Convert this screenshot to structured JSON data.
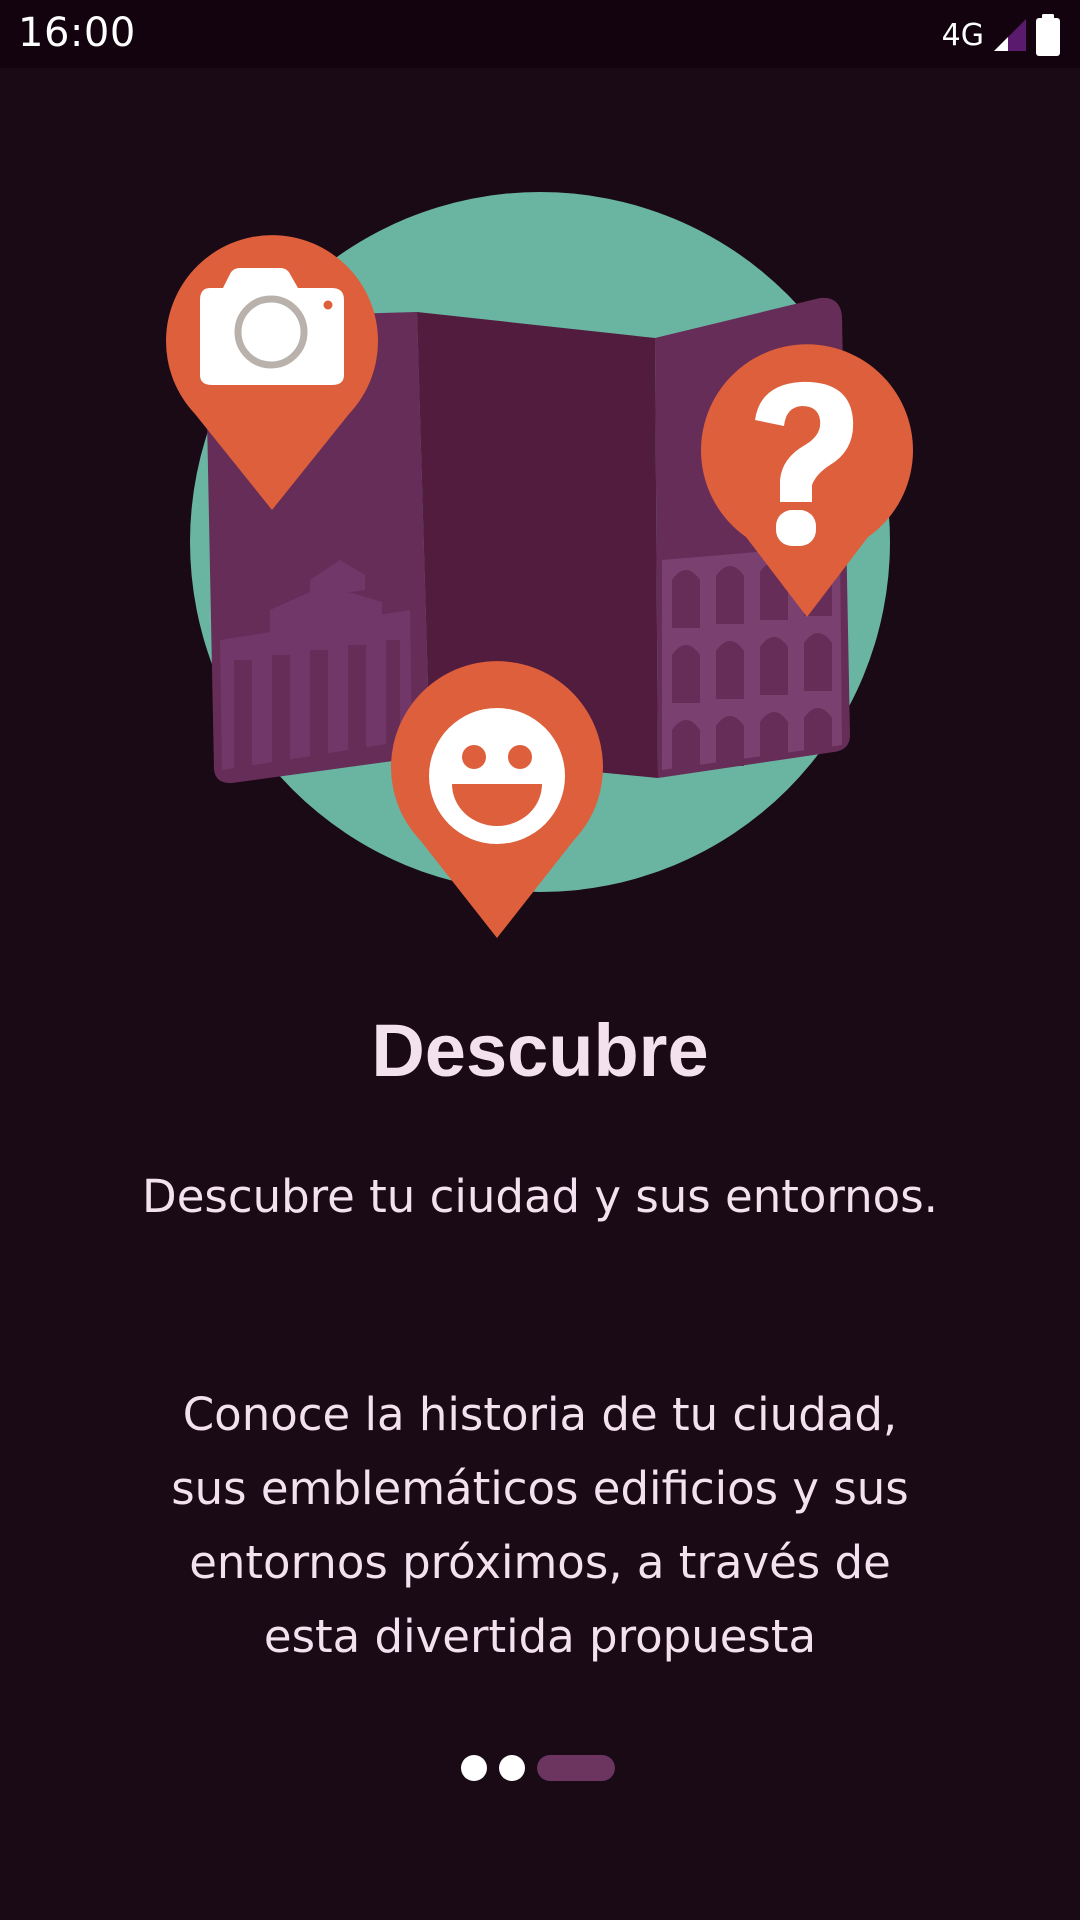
{
  "status_bar": {
    "time": "16:00",
    "network": "4G",
    "icons": [
      "signal-icon",
      "battery-icon"
    ]
  },
  "onboarding": {
    "title": "Descubre",
    "subtitle": "Descubre tu ciudad y sus entornos.",
    "body": "Conoce la historia de tu ciudad, sus emblemáticos edificios y sus entornos próximos, a través de esta divertida propuesta",
    "page_indicator": {
      "total": 3,
      "current": 3
    }
  },
  "illustration": {
    "icons": [
      "map-icon",
      "camera-pin-icon",
      "question-pin-icon",
      "smiley-pin-icon"
    ]
  },
  "colors": {
    "background": "#190a15",
    "status_bar": "#12030e",
    "text": "#f3e1ee",
    "circle": "#6ab5a2",
    "map_dark": "#511c3d",
    "map_light": "#652d57",
    "pin": "#dd5f3c",
    "indicator_active": "#6b3560",
    "indicator_inactive": "#ffffff"
  }
}
